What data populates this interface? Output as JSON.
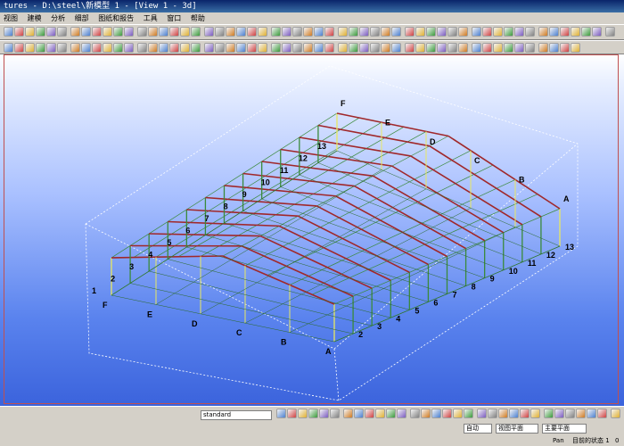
{
  "window": {
    "title": "tures - D:\\steel\\新模型 1 - [View 1 - 3d]"
  },
  "menu": {
    "items": [
      "视图",
      "建模",
      "分析",
      "细部",
      "图纸和报告",
      "工具",
      "窗口",
      "帮助"
    ]
  },
  "viewport": {
    "grid_labels_numbers": [
      "1",
      "2",
      "3",
      "4",
      "5",
      "6",
      "7",
      "8",
      "9",
      "10",
      "11",
      "12",
      "13"
    ],
    "grid_labels_letters": [
      "A",
      "B",
      "C",
      "D",
      "E",
      "F"
    ],
    "top_labels": [
      "2",
      "3",
      "4",
      "5",
      "6",
      "7",
      "8",
      "9",
      "10",
      "11",
      "12",
      "13"
    ],
    "right_labels": [
      "A",
      "B",
      "C",
      "D",
      "E",
      "F"
    ]
  },
  "bottom_toolbar": {
    "combo_standard": "standard",
    "combo_auto": "自动",
    "combo_view_plane": "视图平面",
    "combo_main_plane": "主要平面"
  },
  "status": {
    "pan": "Pan",
    "current_status": "目前的状态 1",
    "page": "0"
  },
  "colors": {
    "frame_green": "#3a8a3a",
    "rafter_red": "#a0282a",
    "column_yellow": "#e8e860"
  }
}
